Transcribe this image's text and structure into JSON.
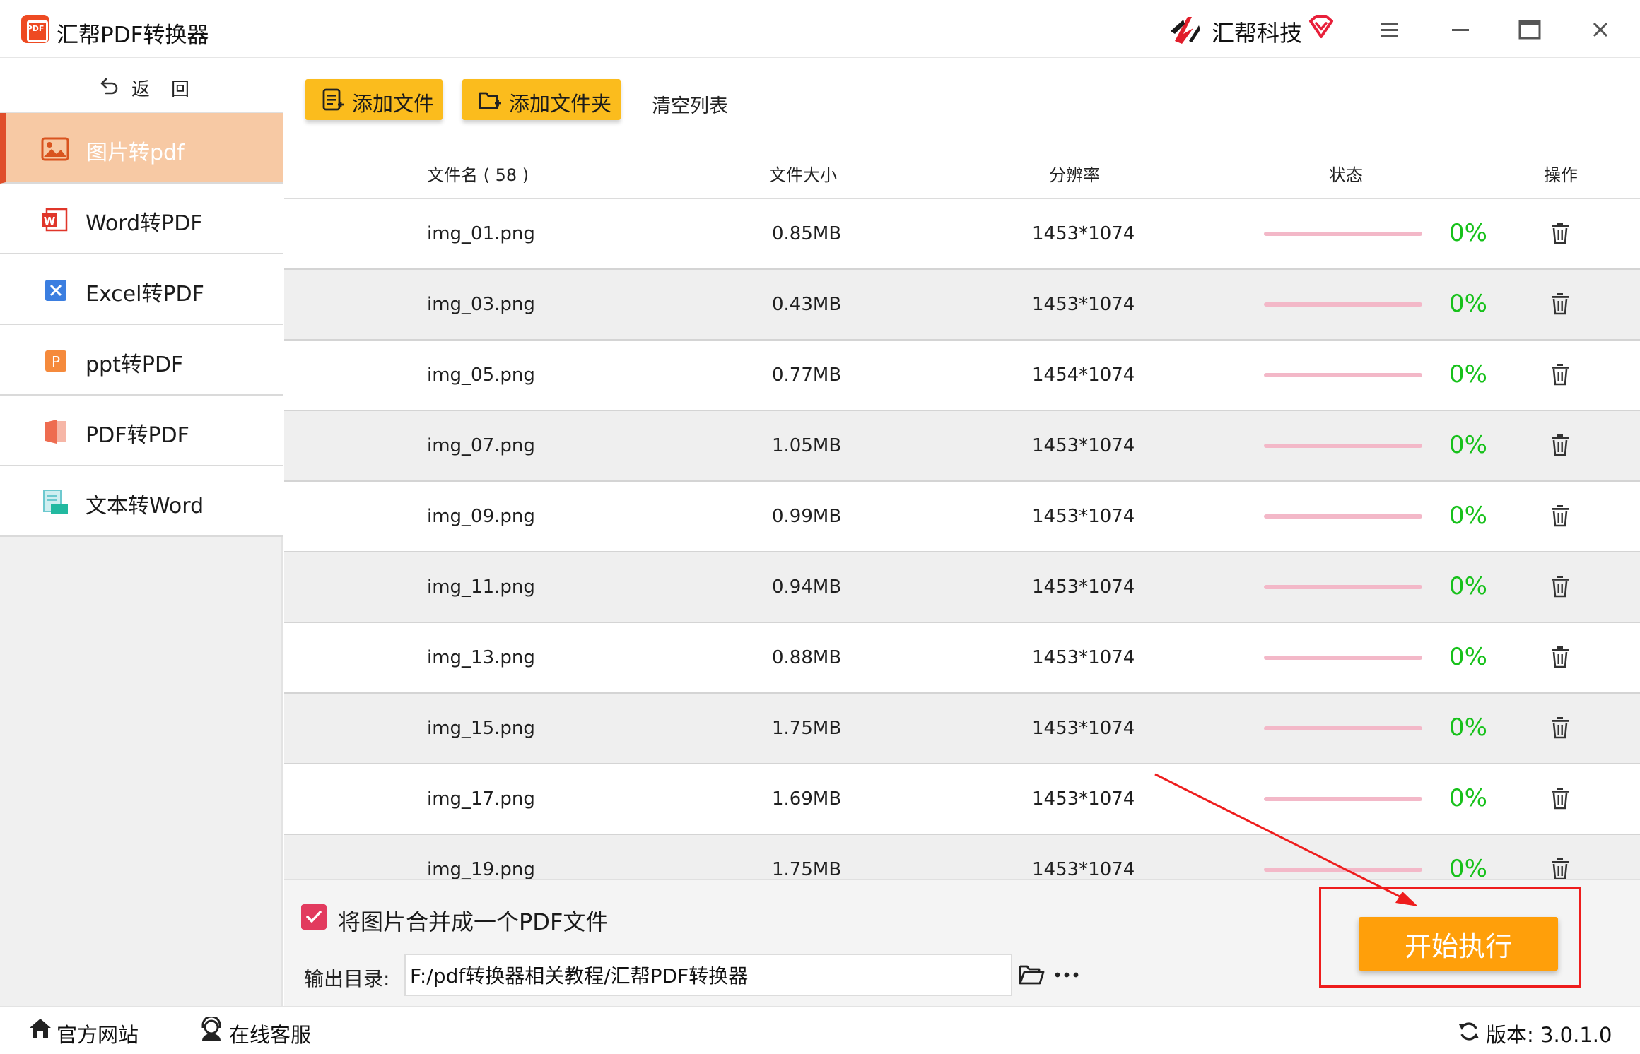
{
  "app": {
    "logo_text": "PDF",
    "title": "汇帮PDF转换器",
    "brand": "汇帮科技"
  },
  "sidebar": {
    "back_label": "返回",
    "items": [
      {
        "label": "图片转pdf",
        "icon": "image-icon",
        "active": true
      },
      {
        "label": "Word转PDF",
        "icon": "word-icon",
        "active": false
      },
      {
        "label": "Excel转PDF",
        "icon": "excel-icon",
        "active": false
      },
      {
        "label": "ppt转PDF",
        "icon": "ppt-icon",
        "active": false
      },
      {
        "label": "PDF转PDF",
        "icon": "pdf-icon",
        "active": false
      },
      {
        "label": "文本转Word",
        "icon": "text-icon",
        "active": false
      }
    ]
  },
  "toolbar": {
    "add_file": "添加文件",
    "add_folder": "添加文件夹",
    "clear_list": "清空列表"
  },
  "table": {
    "headers": {
      "name": "文件名 ( 58 )",
      "size": "文件大小",
      "resolution": "分辨率",
      "status": "状态",
      "operation": "操作"
    },
    "rows": [
      {
        "name": "img_01.png",
        "size": "0.85MB",
        "resolution": "1453*1074",
        "percent": "0%",
        "progress": 0
      },
      {
        "name": "img_03.png",
        "size": "0.43MB",
        "resolution": "1453*1074",
        "percent": "0%",
        "progress": 0
      },
      {
        "name": "img_05.png",
        "size": "0.77MB",
        "resolution": "1454*1074",
        "percent": "0%",
        "progress": 0
      },
      {
        "name": "img_07.png",
        "size": "1.05MB",
        "resolution": "1453*1074",
        "percent": "0%",
        "progress": 0
      },
      {
        "name": "img_09.png",
        "size": "0.99MB",
        "resolution": "1453*1074",
        "percent": "0%",
        "progress": 0
      },
      {
        "name": "img_11.png",
        "size": "0.94MB",
        "resolution": "1453*1074",
        "percent": "0%",
        "progress": 0
      },
      {
        "name": "img_13.png",
        "size": "0.88MB",
        "resolution": "1453*1074",
        "percent": "0%",
        "progress": 0
      },
      {
        "name": "img_15.png",
        "size": "1.75MB",
        "resolution": "1453*1074",
        "percent": "0%",
        "progress": 0
      },
      {
        "name": "img_17.png",
        "size": "1.69MB",
        "resolution": "1453*1074",
        "percent": "0%",
        "progress": 0
      },
      {
        "name": "img_19.png",
        "size": "1.75MB",
        "resolution": "1453*1074",
        "percent": "0%",
        "progress": 0
      }
    ]
  },
  "options": {
    "merge_checked": true,
    "merge_label": "将图片合并成一个PDF文件",
    "output_label": "输出目录:",
    "output_path": "F:/pdf转换器相关教程/汇帮PDF转换器",
    "start_button": "开始执行"
  },
  "statusbar": {
    "website": "官方网站",
    "service": "在线客服",
    "version": "版本: 3.0.1.0"
  },
  "colors": {
    "accent": "#fbbc1d",
    "active_nav": "#f7c9a4",
    "progress_track": "#f3b8c8",
    "percent_text": "#17c11b",
    "start_button": "#ff9f0a",
    "annotation_red": "#ee1c1c"
  }
}
